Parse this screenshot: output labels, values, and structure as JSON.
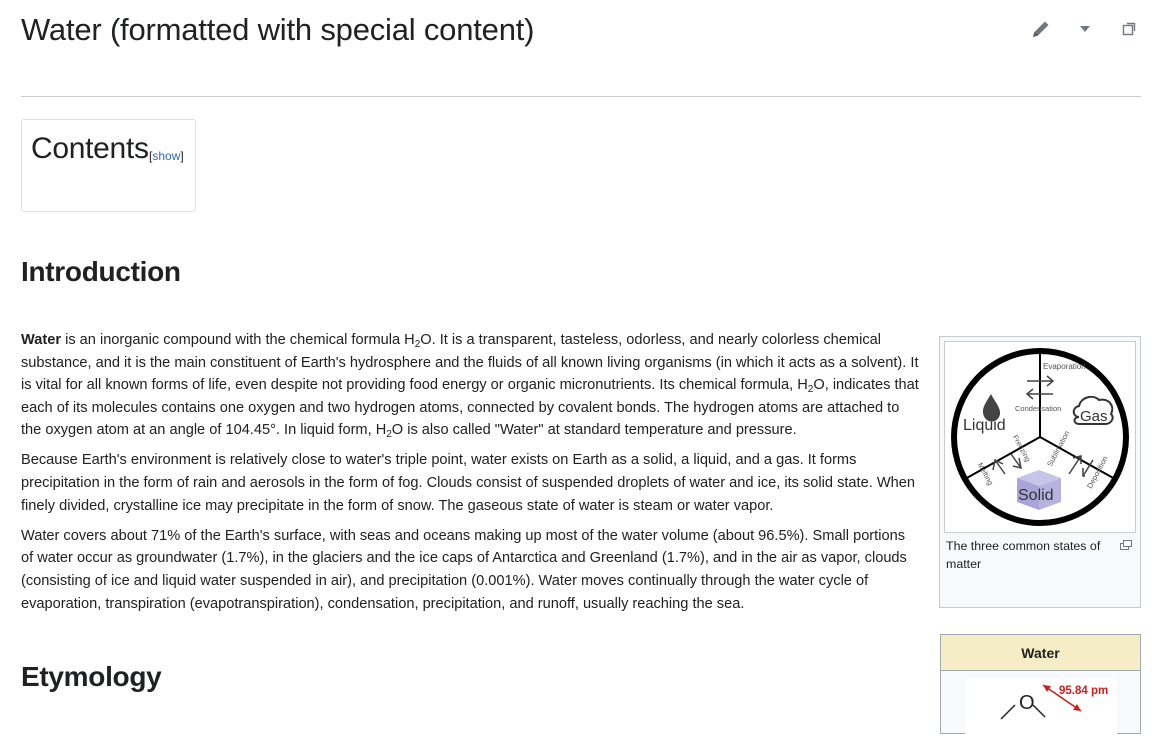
{
  "page": {
    "title": "Water (formatted with special content)"
  },
  "tools": {
    "edit_icon": "pencil-icon",
    "menu_icon": "dropdown-caret-icon",
    "expand_icon": "expand-icon"
  },
  "toc": {
    "title": "Contents",
    "toggle_open": "[",
    "toggle_label": "show",
    "toggle_close": "]"
  },
  "sections": {
    "introduction": "Introduction",
    "etymology": "Etymology"
  },
  "intro": {
    "p1": {
      "bold_word": "Water",
      "a": " is an inorganic compound with the chemical formula H",
      "sub1": "2",
      "b": "O. It is a transparent, tasteless, odorless, and nearly colorless chemical substance, and it is the main constituent of Earth's hydrosphere and the fluids of all known living organisms (in which it acts as a solvent). It is vital for all known forms of life, even despite not providing food energy or organic micronutrients. Its chemical formula, H",
      "sub2": "2",
      "c": "O, indicates that each of its molecules contains one oxygen and two hydrogen atoms, connected by covalent bonds. The hydrogen atoms are attached to the oxygen atom at an angle of 104.45°. In liquid form, H",
      "sub3": "2",
      "d": "O is also called \"Water\" at standard temperature and pressure."
    },
    "p2": "Because Earth's environment is relatively close to water's triple point, water exists on Earth as a solid, a liquid, and a gas. It forms precipitation in the form of rain and aerosols in the form of fog. Clouds consist of suspended droplets of water and ice, its solid state. When finely divided, crystalline ice may precipitate in the form of snow. The gaseous state of water is steam or water vapor.",
    "p3": "Water covers about 71% of the Earth's surface, with seas and oceans making up most of the water volume (about 96.5%). Small portions of water occur as groundwater (1.7%), in the glaciers and the ice caps of Antarctica and Greenland (1.7%), and in the air as vapor, clouds (consisting of ice and liquid water suspended in air), and precipitation (0.001%). Water moves continually through the water cycle of evaporation, transpiration (evapotranspiration), condensation, precipitation, and runoff, usually reaching the sea."
  },
  "figure": {
    "caption": "The three common states of matter",
    "labels": {
      "liquid": "Liquid",
      "gas": "Gas",
      "solid": "Solid",
      "evaporation": "Evaporation",
      "condensation": "Condensation",
      "freezing": "Freezing",
      "melting": "Melting",
      "sublimation": "Sublimation",
      "deposition": "Deposition"
    }
  },
  "infobox": {
    "title": "Water",
    "bond_length": "95.84 pm",
    "atom_label": "O"
  }
}
